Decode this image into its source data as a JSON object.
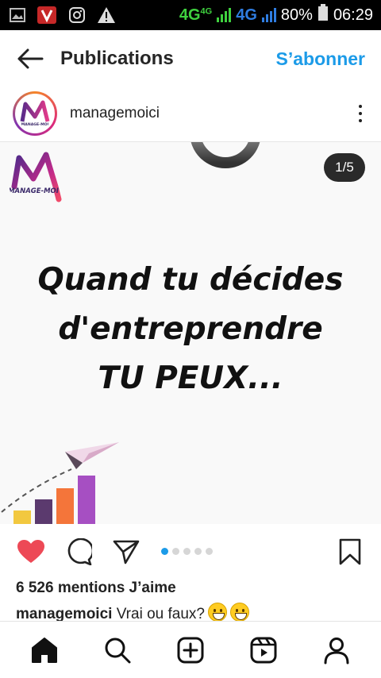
{
  "status_bar": {
    "network_1": "4G",
    "network_1_sup": "4G",
    "network_2": "4G",
    "battery": "80%",
    "time": "06:29",
    "icons": [
      "gallery-icon",
      "vlc-icon",
      "instagram-icon",
      "warning-icon",
      "signal-icon",
      "battery-icon"
    ]
  },
  "header": {
    "title": "Publications",
    "subscribe_label": "S’abonner"
  },
  "account": {
    "username": "managemoici",
    "avatar_text": "MANAGE-MOI"
  },
  "post": {
    "counter": "1/5",
    "brand_text": "MANAGE-MOI",
    "headline": [
      "Quand tu décides",
      "d'entreprendre",
      "TU PEUX..."
    ],
    "carousel_total": 5,
    "carousel_index": 0,
    "colors": {
      "bar_1": "#f2c83f",
      "bar_2": "#5b3a6e",
      "bar_3": "#f4753a",
      "bar_4": "#a64fc2",
      "accent": "#1c9be8",
      "like": "#ed4956"
    }
  },
  "engagement": {
    "likes": "6 526 mentions J’aime",
    "caption_user": "managemoici",
    "caption_text": "Vrai ou faux?"
  },
  "bottom_nav": [
    "home-icon",
    "search-icon",
    "new-post-icon",
    "reels-icon",
    "profile-icon"
  ]
}
